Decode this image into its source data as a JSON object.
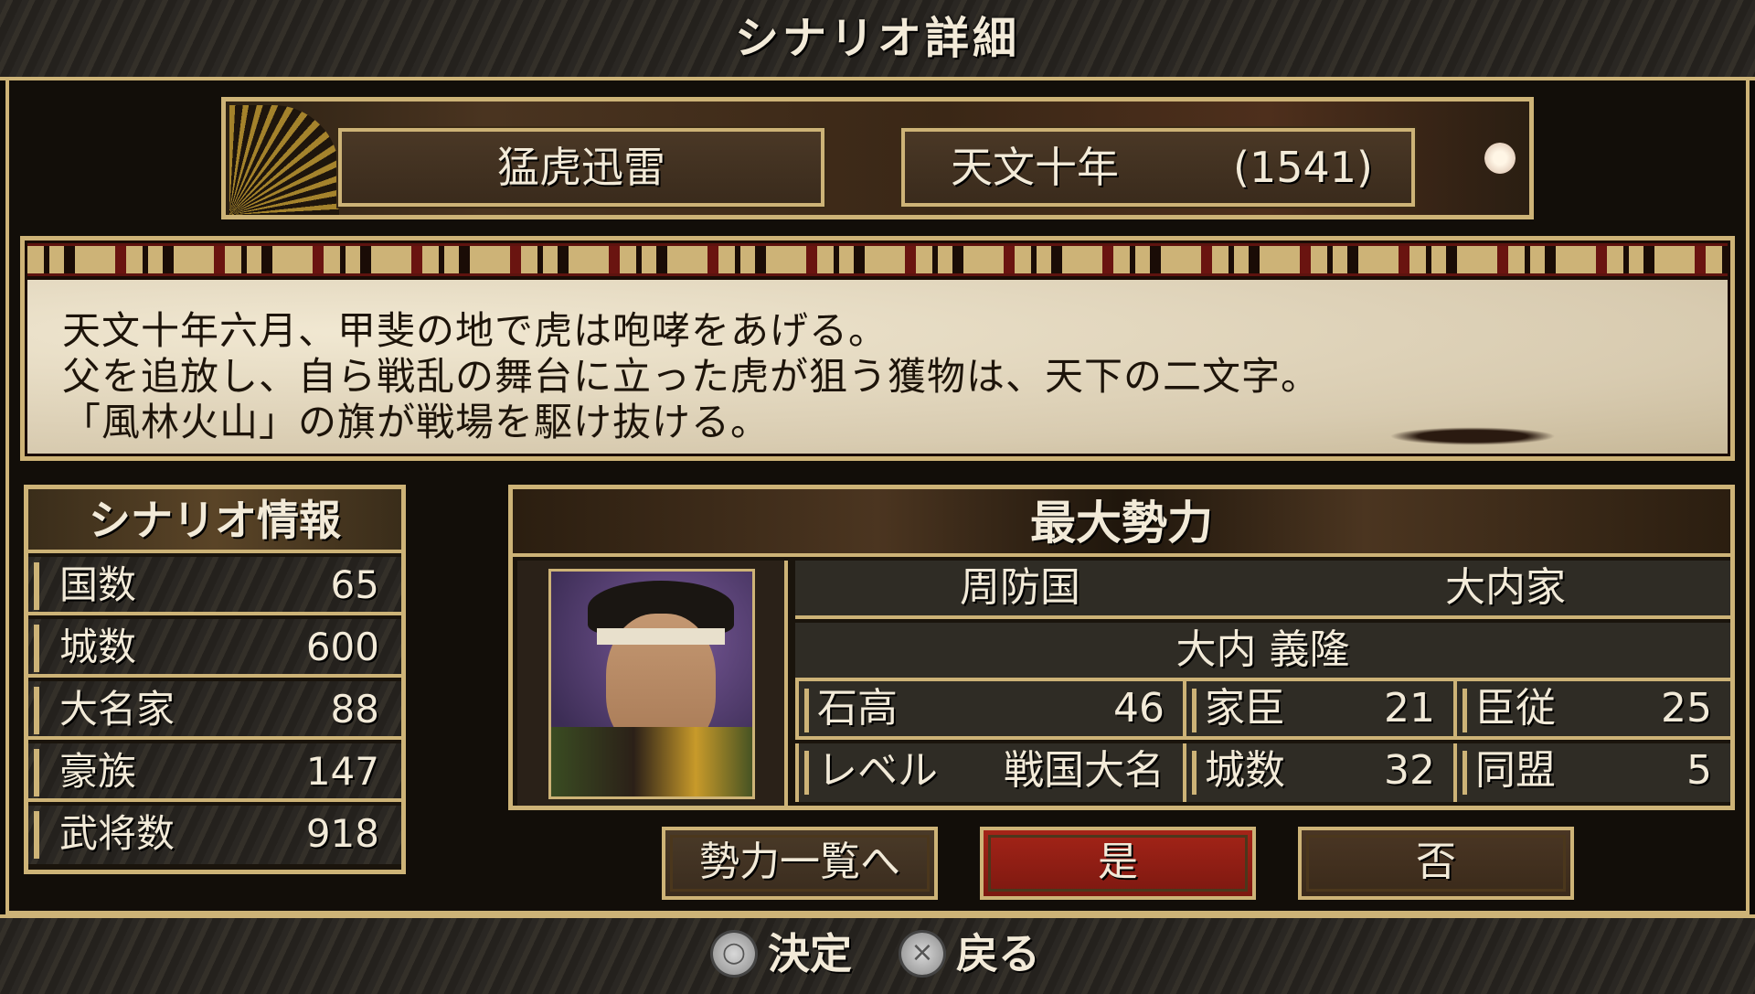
{
  "title": "シナリオ詳細",
  "scenario": {
    "name": "猛虎迅雷",
    "era_date": "天文十年",
    "year": "(1541)"
  },
  "description": {
    "line1": "天文十年六月、甲斐の地で虎は咆哮をあげる。",
    "line2": "父を追放し、自ら戦乱の舞台に立った虎が狙う獲物は、天下の二文字。",
    "line3": "「風林火山」の旗が戦場を駆け抜ける。"
  },
  "scenario_info": {
    "header": "シナリオ情報",
    "rows": [
      {
        "label": "国数",
        "value": "65"
      },
      {
        "label": "城数",
        "value": "600"
      },
      {
        "label": "大名家",
        "value": "88"
      },
      {
        "label": "豪族",
        "value": "147"
      },
      {
        "label": "武将数",
        "value": "918"
      }
    ]
  },
  "strongest_force": {
    "header": "最大勢力",
    "province": "周防国",
    "clan": "大内家",
    "daimyo": "大内 義隆",
    "stats": {
      "koku": {
        "label": "石高",
        "value": "46"
      },
      "vassals": {
        "label": "家臣",
        "value": "21"
      },
      "retainers": {
        "label": "臣従",
        "value": "25"
      },
      "level": {
        "label": "レベル",
        "value": "戦国大名"
      },
      "castles": {
        "label": "城数",
        "value": "32"
      },
      "allies": {
        "label": "同盟",
        "value": "5"
      }
    }
  },
  "buttons": {
    "forces_list": "勢力一覧へ",
    "yes": "是",
    "no": "否"
  },
  "footer": {
    "confirm_icon": "○",
    "confirm_label": "決定",
    "back_icon": "×",
    "back_label": "戻る"
  },
  "colors": {
    "gold_border": "#cdb377",
    "yes_button": "#a42418"
  }
}
